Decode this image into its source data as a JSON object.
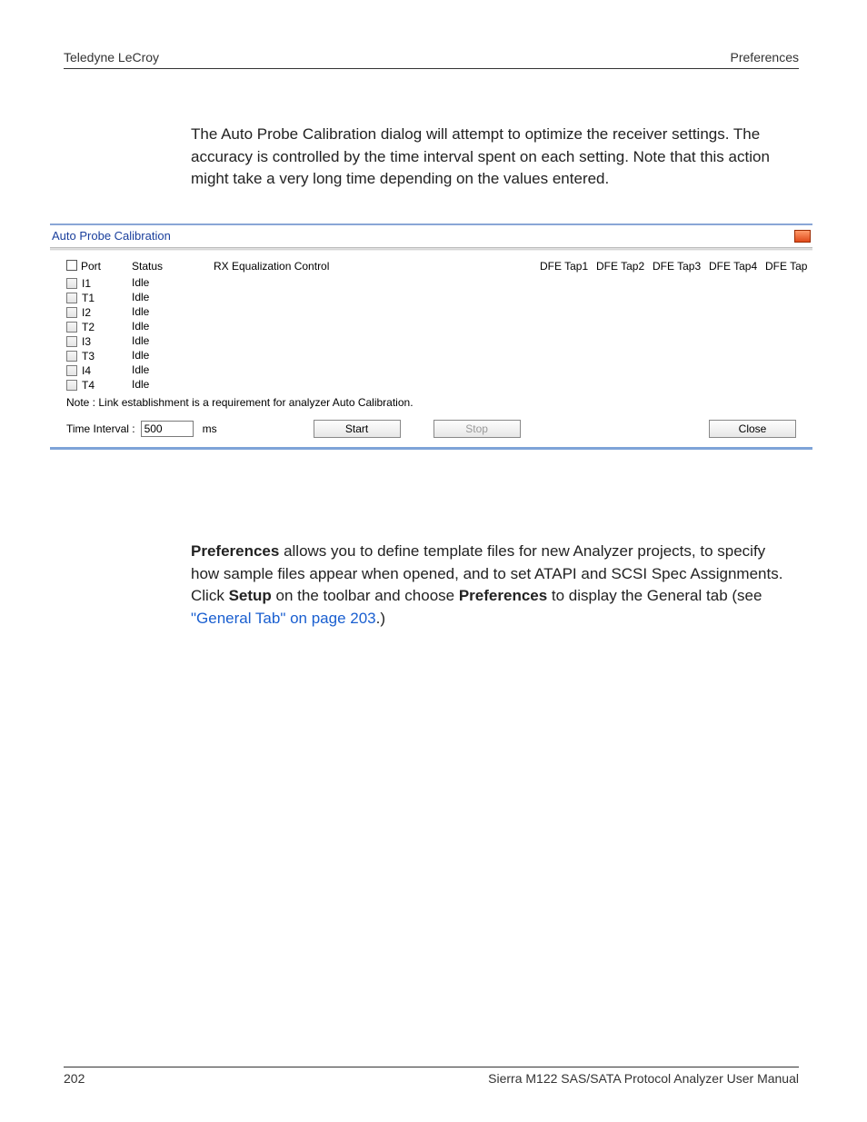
{
  "header": {
    "left": "Teledyne LeCroy",
    "right": "Preferences"
  },
  "intro": "The Auto Probe Calibration dialog will attempt to optimize the receiver settings. The accuracy is controlled by the time interval spent on each setting. Note that this action might take a very long time depending on the values entered.",
  "dialog": {
    "title": "Auto Probe Calibration",
    "columns": {
      "port": "Port",
      "status": "Status",
      "rx": "RX Equalization Control",
      "dfe": [
        "DFE Tap1",
        "DFE Tap2",
        "DFE Tap3",
        "DFE Tap4",
        "DFE Tap"
      ]
    },
    "rows": [
      {
        "port": "I1",
        "status": "Idle"
      },
      {
        "port": "T1",
        "status": "Idle"
      },
      {
        "port": "I2",
        "status": "Idle"
      },
      {
        "port": "T2",
        "status": "Idle"
      },
      {
        "port": "I3",
        "status": "Idle"
      },
      {
        "port": "T3",
        "status": "Idle"
      },
      {
        "port": "I4",
        "status": "Idle"
      },
      {
        "port": "T4",
        "status": "Idle"
      }
    ],
    "note": "Note : Link establishment is a requirement for analyzer Auto Calibration.",
    "time_label": "Time Interval :",
    "time_value": "500",
    "time_unit": "ms",
    "buttons": {
      "start": "Start",
      "stop": "Stop",
      "close": "Close"
    }
  },
  "prefs": {
    "bold1": "Preferences",
    "text1": " allows you to define template files for new Analyzer projects, to specify how sample files appear when opened, and to set ATAPI and SCSI Spec Assignments. Click ",
    "bold2": "Setup",
    "text2": " on the toolbar and choose ",
    "bold3": "Preferences",
    "text3": " to display the General tab (see ",
    "link": "\"General Tab\" on page 203",
    "text4": ".)"
  },
  "footer": {
    "left": "202",
    "right": "Sierra M122 SAS/SATA Protocol Analyzer User Manual"
  }
}
